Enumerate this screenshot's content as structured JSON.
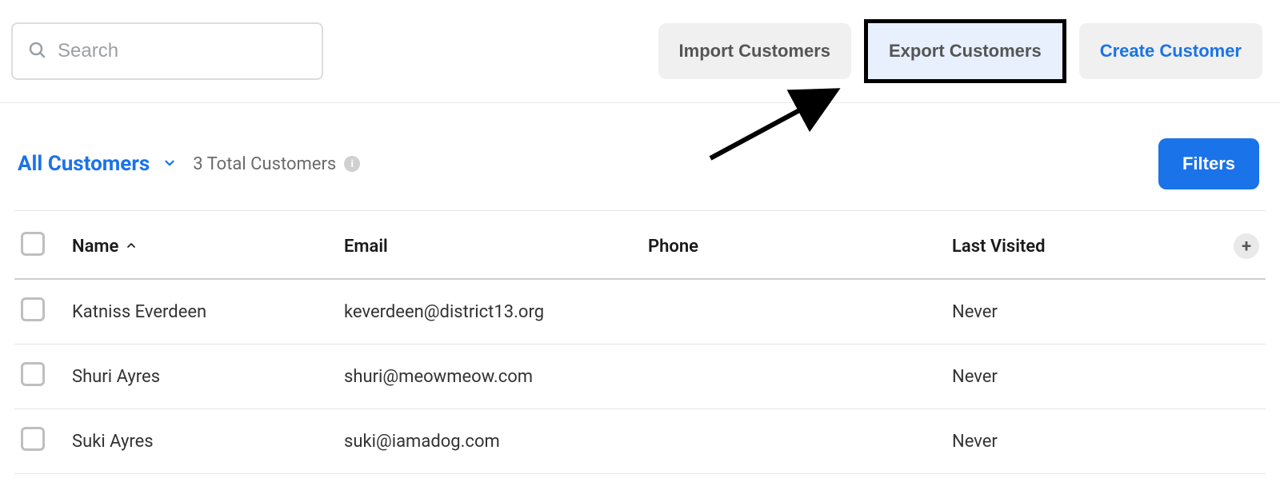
{
  "search": {
    "placeholder": "Search",
    "value": ""
  },
  "actions": {
    "import_label": "Import Customers",
    "export_label": "Export Customers",
    "create_label": "Create Customer"
  },
  "dropdown": {
    "title": "All Customers"
  },
  "summary": {
    "total_text": "3 Total Customers"
  },
  "filters_label": "Filters",
  "columns": {
    "name": "Name",
    "email": "Email",
    "phone": "Phone",
    "last_visited": "Last Visited"
  },
  "rows": [
    {
      "name": "Katniss Everdeen",
      "email": "keverdeen@district13.org",
      "phone": "",
      "last_visited": "Never"
    },
    {
      "name": "Shuri Ayres",
      "email": "shuri@meowmeow.com",
      "phone": "",
      "last_visited": "Never"
    },
    {
      "name": "Suki Ayres",
      "email": "suki@iamadog.com",
      "phone": "",
      "last_visited": "Never"
    }
  ]
}
